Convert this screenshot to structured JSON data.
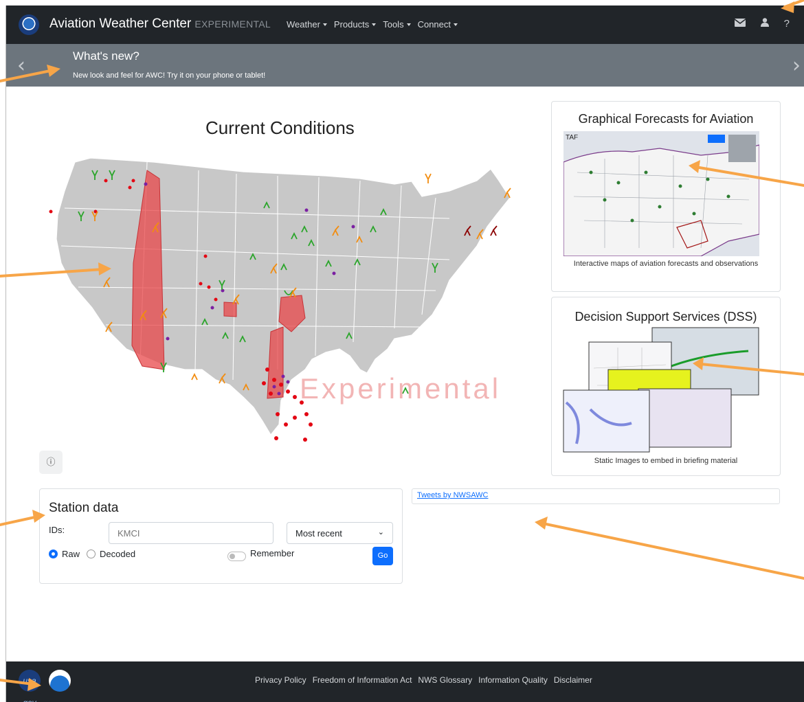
{
  "navbar": {
    "brand": "Aviation Weather Center",
    "brand_tag": "EXPERIMENTAL",
    "menu": [
      {
        "label": "Weather"
      },
      {
        "label": "Products"
      },
      {
        "label": "Tools"
      },
      {
        "label": "Connect"
      }
    ],
    "icons": [
      "mail-icon",
      "user-icon",
      "help-icon"
    ],
    "help_glyph": "?"
  },
  "banner": {
    "title": "What's new?",
    "text": "New look and feel for AWC! Try it on your phone or tablet!"
  },
  "main": {
    "title": "Current Conditions",
    "watermark": "Experimental",
    "info_glyph": "ⓘ"
  },
  "cards": {
    "gfa": {
      "title": "Graphical Forecasts for Aviation",
      "map_label": "TAF",
      "caption": "Interactive maps of aviation forecasts and observations"
    },
    "dss": {
      "title": "Decision Support Services (DSS)",
      "caption": "Static Images to embed in briefing material"
    }
  },
  "station": {
    "title": "Station data",
    "ids_label": "IDs:",
    "ids_placeholder": "KMCI",
    "select_value": "Most recent",
    "radio_raw": "Raw",
    "radio_decoded": "Decoded",
    "remember": "Remember",
    "go": "Go"
  },
  "tweets": {
    "link": "Tweets by NWSAWC"
  },
  "footer": {
    "usa_gov": "usa gov",
    "links": [
      {
        "label": "Privacy Policy"
      },
      {
        "label": "Freedom of Information Act"
      },
      {
        "label": "NWS Glossary"
      },
      {
        "label": "Information Quality"
      },
      {
        "label": "Disclaimer"
      }
    ]
  },
  "colors": {
    "navbar": "#212529",
    "banner": "#6c757d",
    "primary": "#0d6efd",
    "arrow": "#f7a548",
    "sigmet": "#e8474a"
  }
}
